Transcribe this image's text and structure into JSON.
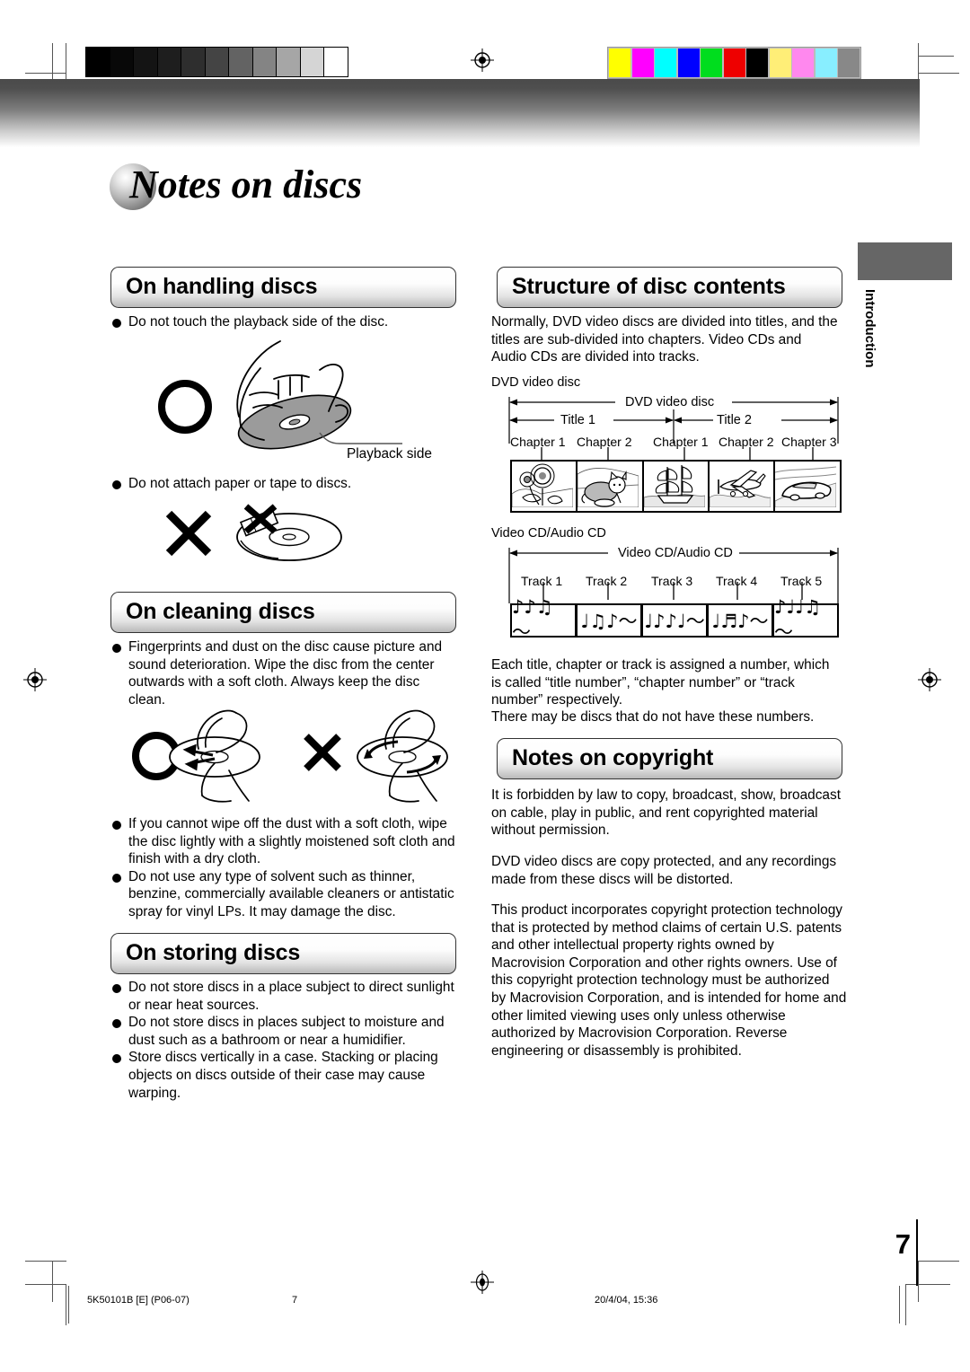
{
  "document": {
    "title": "Notes on discs",
    "page_number": "7",
    "side_tab": "Introduction"
  },
  "printer_marks": {
    "grayscale_bar": [
      "#000000",
      "#080808",
      "#141414",
      "#1e1e1e",
      "#2e2e2e",
      "#444444",
      "#636363",
      "#848484",
      "#a6a6a6",
      "#d5d5d5",
      "#ffffff"
    ],
    "color_bar": [
      "#ffff00",
      "#ff00ff",
      "#00ffff",
      "#0000ff",
      "#00dd1e",
      "#ee0000",
      "#000000",
      "#ffee77",
      "#ff88ee",
      "#88eeff",
      "#888888"
    ]
  },
  "left_column": {
    "handling": {
      "heading": "On handling discs",
      "bullets": [
        "Do not touch the playback side of the disc.",
        "Do not attach paper or tape to discs."
      ],
      "callout": "Playback side"
    },
    "cleaning": {
      "heading": "On cleaning discs",
      "bullet_first": "Fingerprints and dust on the disc cause picture and sound deterioration. Wipe the disc from the center outwards with a soft cloth. Always keep the disc clean.",
      "bullets_after": [
        "If you cannot wipe off the dust with a soft cloth, wipe the disc lightly with a slightly moistened soft cloth and finish with a dry cloth.",
        "Do not use any type of solvent such as thinner, benzine, commercially available cleaners or antistatic spray for vinyl LPs. It may damage the disc."
      ]
    },
    "storing": {
      "heading": "On storing discs",
      "bullets": [
        "Do not store discs in a place subject to direct sunlight or near heat sources.",
        "Do not store discs in places subject to moisture and dust such as a bathroom or near a humidifier.",
        "Store discs vertically in a case. Stacking or placing objects on discs outside of their case may cause warping."
      ]
    }
  },
  "right_column": {
    "structure": {
      "heading": "Structure of disc contents",
      "intro": "Normally, DVD video discs are divided into titles, and the titles are sub-divided into chapters. Video CDs and Audio CDs are divided into tracks.",
      "dvd_caption": "DVD video disc",
      "dvd_span_label": "DVD video disc",
      "dvd_titles": [
        {
          "label": "Title 1",
          "chapters": [
            "Chapter 1",
            "Chapter 2"
          ]
        },
        {
          "label": "Title 2",
          "chapters": [
            "Chapter 1",
            "Chapter 2",
            "Chapter 3"
          ]
        }
      ],
      "cd_caption": "Video CD/Audio CD",
      "cd_span_label": "Video CD/Audio CD",
      "cd_tracks": [
        {
          "label": "Track 1",
          "notes": "♪♪♫  ～"
        },
        {
          "label": "Track 2",
          "notes": "♩♫♪～"
        },
        {
          "label": "Track 3",
          "notes": "♩♪♪♩～"
        },
        {
          "label": "Track 4",
          "notes": "♩♬♪～"
        },
        {
          "label": "Track 5",
          "notes": "♪♩♩♫～"
        }
      ],
      "outro_1": "Each title, chapter or track is assigned a number, which is called “title number”, “chapter number” or “track number” respectively.",
      "outro_2": "There may be discs that do not have these numbers."
    },
    "copyright": {
      "heading": "Notes on copyright",
      "paragraphs": [
        "It is forbidden by law to copy, broadcast, show, broadcast on cable, play in public, and rent copyrighted material without permission.",
        "DVD video discs are copy protected, and any recordings made from these discs will be distorted.",
        "This product incorporates copyright protection technology that is protected by method claims of certain U.S. patents and other intellectual property rights owned by Macrovision Corporation and other rights owners. Use of this copyright protection technology must be authorized by Macrovision Corporation, and is intended for home and other limited viewing uses only unless otherwise authorized by Macrovision Corporation. Reverse engineering or disassembly is prohibited."
      ]
    }
  },
  "footer": {
    "doc_code": "5K50101B [E] (P06-07)",
    "page": "7",
    "timestamp": "20/4/04, 15:36"
  }
}
